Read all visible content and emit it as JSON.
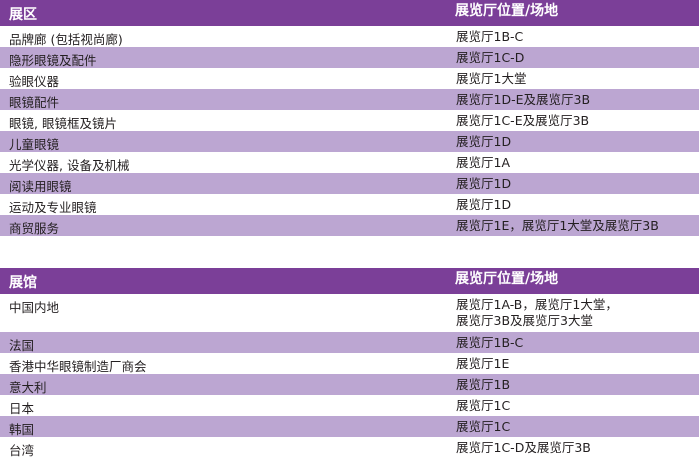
{
  "section1": {
    "header": {
      "col1": "展区",
      "col2": "展览厅位置/场地"
    },
    "rows": [
      {
        "name": "品牌廊 (包括视尚廊)",
        "location": "展览厅1B-C"
      },
      {
        "name": "隐形眼镜及配件",
        "location": "展览厅1C-D"
      },
      {
        "name": "验眼仪器",
        "location": "展览厅1大堂"
      },
      {
        "name": "眼镜配件",
        "location": "展览厅1D-E及展览厅3B"
      },
      {
        "name": "眼镜, 眼镜框及镜片",
        "location": "展览厅1C-E及展览厅3B"
      },
      {
        "name": "儿童眼镜",
        "location": "展览厅1D"
      },
      {
        "name": "光学仪器, 设备及机械",
        "location": "展览厅1A"
      },
      {
        "name": "阅读用眼镜",
        "location": "展览厅1D"
      },
      {
        "name": "运动及专业眼镜",
        "location": "展览厅1D"
      },
      {
        "name": "商贸服务",
        "location": "展览厅1E，展览厅1大堂及展览厅3B"
      }
    ]
  },
  "section2": {
    "header": {
      "col1": "展馆",
      "col2": "展览厅位置/场地"
    },
    "rows": [
      {
        "name": "中国内地",
        "location": "展览厅1A-B，展览厅1大堂，",
        "location2": "展览厅3B及展览厅3大堂"
      },
      {
        "name": "法国",
        "location": "展览厅1B-C"
      },
      {
        "name": "香港中华眼镜制造厂商会",
        "location": "展览厅1E"
      },
      {
        "name": "意大利",
        "location": "展览厅1B"
      },
      {
        "name": "日本",
        "location": "展览厅1C"
      },
      {
        "name": "韩国",
        "location": "展览厅1C"
      },
      {
        "name": "台湾",
        "location": "展览厅1C-D及展览厅3B"
      }
    ]
  }
}
